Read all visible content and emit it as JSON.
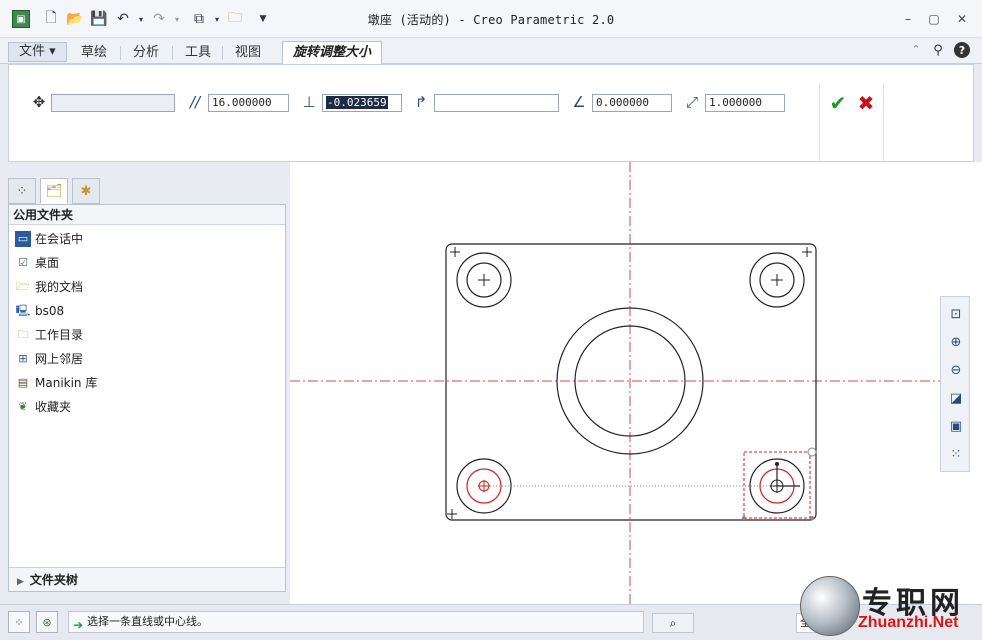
{
  "window": {
    "title": "墩座 (活动的) - Creo Parametric 2.0"
  },
  "quick_access": {
    "icons": [
      "app-icon",
      "new-icon",
      "open-icon",
      "save-icon",
      "undo-icon",
      "redo-icon",
      "regenerate-icon",
      "window-icon",
      "customize-icon"
    ]
  },
  "tabs": {
    "file": "文件 ▾",
    "sketch": "草绘",
    "analysis": "分析",
    "tools": "工具",
    "view": "视图",
    "rotate_resize": "旋转调整大小"
  },
  "dashboard": {
    "move_value": "",
    "offset_value": "16.000000",
    "normal_offset_value": "-0.023659",
    "rotate_ref_value": "",
    "angle_value": "0.000000",
    "scale_value": "1.000000"
  },
  "navigator": {
    "header": "公用文件夹",
    "items": [
      {
        "label": "在会话中",
        "icon": "session-icon"
      },
      {
        "label": "桌面",
        "icon": "desktop-icon"
      },
      {
        "label": "我的文档",
        "icon": "my-documents-icon"
      },
      {
        "label": "bs08",
        "icon": "computer-icon"
      },
      {
        "label": "工作目录",
        "icon": "working-directory-icon"
      },
      {
        "label": "网上邻居",
        "icon": "network-icon"
      },
      {
        "label": "Manikin 库",
        "icon": "manikin-library-icon"
      },
      {
        "label": "收藏夹",
        "icon": "favorites-icon"
      }
    ],
    "folder_tree": "文件夹树"
  },
  "status": {
    "message": "选择一条直线或中心线。",
    "filter": "全"
  },
  "watermark": {
    "text": "专职网",
    "url": "Zhuanzhi.Net"
  },
  "colors": {
    "selection_red": "#d81e1e",
    "centerline": "#d84a4a",
    "ok_green": "#1a9a2a",
    "cancel_red": "#c81414"
  }
}
